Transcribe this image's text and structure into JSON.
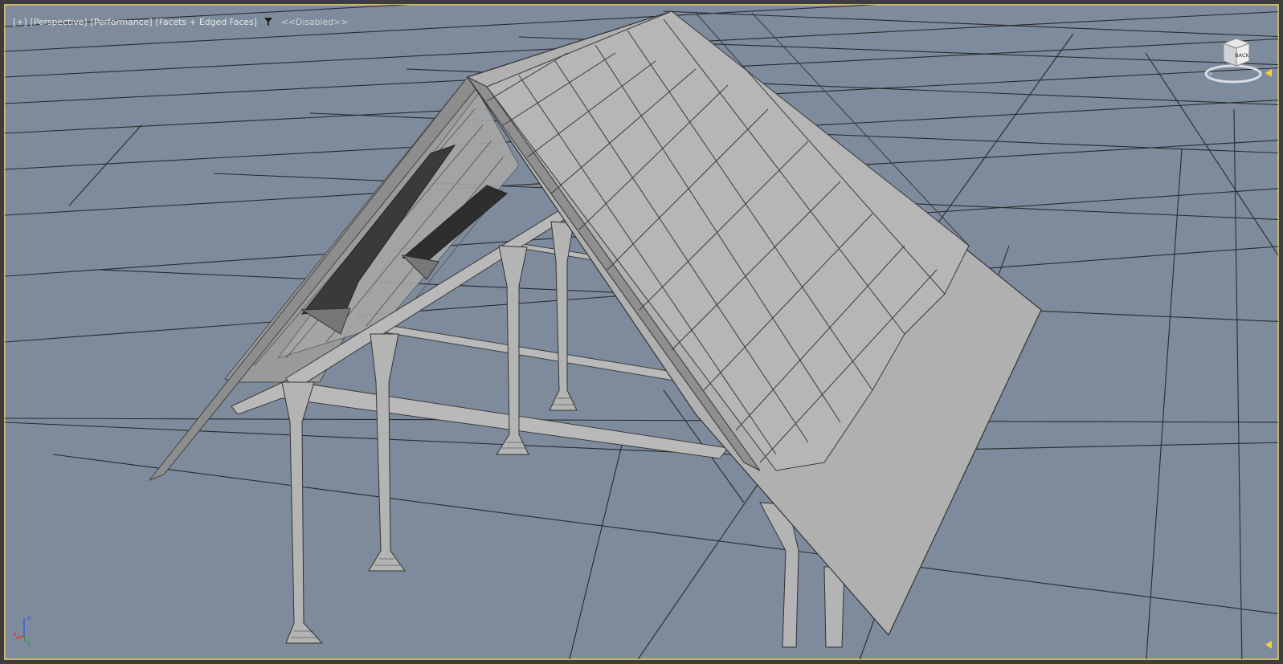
{
  "viewport": {
    "labels": {
      "plus": "[+]",
      "view": "[Perspective]",
      "mode": "[Performance]",
      "shading": "[Facets + Edged Faces]",
      "filter_state": "<<Disabled>>"
    },
    "filter_icon": "funnel-icon",
    "viewcube": {
      "face": "BACK",
      "icon": "viewcube-icon"
    },
    "axis_tripod": {
      "x": "x",
      "y": "y",
      "z": "z"
    },
    "colors": {
      "background": "#7e8b9c",
      "grid": "#222222",
      "model": "#b4b4b4",
      "active_border": "#c8b66a",
      "marker": "#f2d23a"
    }
  }
}
